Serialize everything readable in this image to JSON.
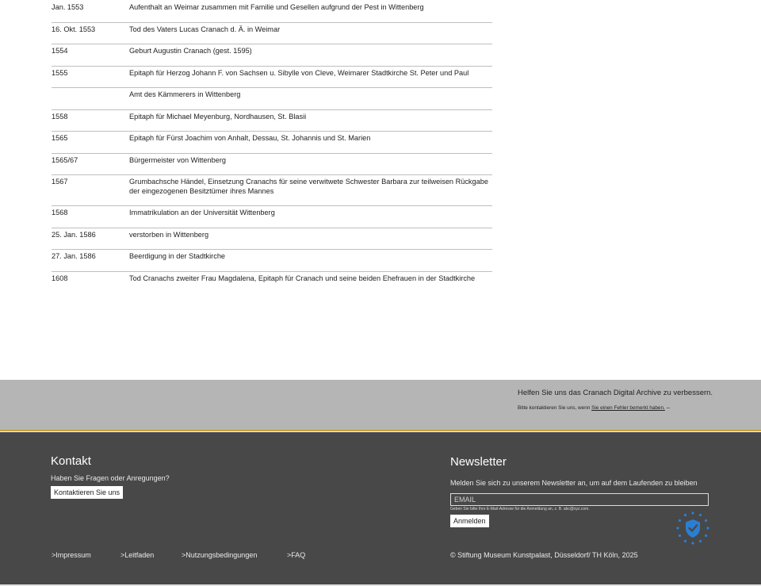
{
  "timeline": [
    {
      "date": "Jan. 1553",
      "text": "Aufenthalt an Weimar zusammen mit Familie und Gesellen aufgrund der Pest in Wittenberg"
    },
    {
      "date": "16. Okt. 1553",
      "text": "Tod des Vaters Lucas Cranach d. Ä. in Weimar"
    },
    {
      "date": "1554",
      "text": "Geburt Augustin Cranach (gest. 1595)"
    },
    {
      "date": "1555",
      "text": "Epitaph für Herzog Johann F. von Sachsen u. Sibylle von Cleve, Weimarer Stadtkirche St. Peter und Paul"
    },
    {
      "date": "",
      "text": "Amt des Kämmerers in Wittenberg"
    },
    {
      "date": "1558",
      "text": "Epitaph für Michael Meyenburg, Nordhausen, St. Blasii"
    },
    {
      "date": "1565",
      "text": "Epitaph für Fürst Joachim von Anhalt, Dessau, St. Johannis und St. Marien"
    },
    {
      "date": "1565/67",
      "text": "Bürgermeister von Wittenberg"
    },
    {
      "date": "1567",
      "text": "Grumbachsche Händel, Einsetzung Cranachs für seine verwitwete  Schwester Barbara zur teilweisen Rückgabe der eingezogenen Besitztümer  ihres Mannes"
    },
    {
      "date": "1568",
      "text": "Immatrikulation an der Universität Wittenberg"
    },
    {
      "date": "25. Jan. 1586",
      "text": "verstorben in Wittenberg"
    },
    {
      "date": "27. Jan. 1586",
      "text": "Beerdigung in der Stadtkirche"
    },
    {
      "date": "1608",
      "text": "Tod Cranachs zweiter Frau Magdalena, Epitaph für Cranach und seine beiden Ehefrauen in der Stadtkirche"
    }
  ],
  "feedback": {
    "title": "Helfen Sie uns das Cranach Digital Archive zu verbessern.",
    "prefix": "Bitte kontaktieren Sie uns, wenn ",
    "link": "Sie einen Fehler bemerkt haben.",
    "icon": "external-link-icon"
  },
  "contact": {
    "title": "Kontakt",
    "question": "Haben Sie Fragen oder Anregungen?",
    "button": "Kontaktieren Sie uns"
  },
  "newsletter": {
    "title": "Newsletter",
    "text": "Melden Sie sich zu unserem Newsletter an, um auf dem Laufenden zu bleiben",
    "placeholder": "EMAIL",
    "hint": "Geben Sie bitte Ihre E-Mail-Adresse für die Anmeldung an, z. B. abc@xyz.com.",
    "button": "Anmelden",
    "badge_icon": "eu-shield-check-icon",
    "badge_color": "#2a7fd4"
  },
  "footer_links": [
    ">Impressum",
    ">Leitfaden",
    ">Nutzungsbedingungen",
    ">FAQ"
  ],
  "copyright": "© Stiftung Museum Kunstpalast, Düsseldorf/ TH Köln, 2025",
  "colors": {
    "footer_bg": "#484848",
    "feedback_bg": "#b5b5b5",
    "accent_line": "#c9a23a"
  }
}
